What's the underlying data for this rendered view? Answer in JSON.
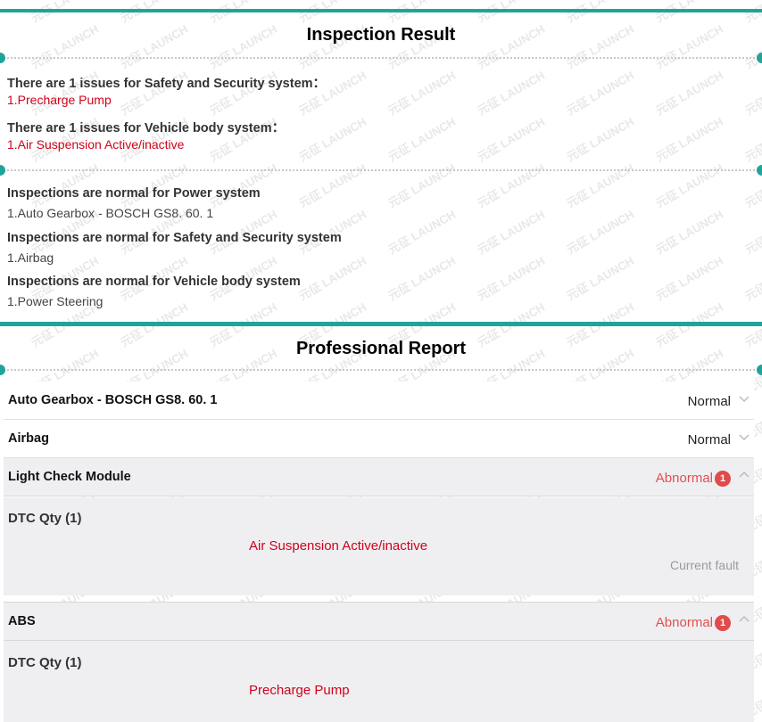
{
  "inspection_result": {
    "title": "Inspection Result",
    "issues": [
      {
        "heading": "There are 1 issues for Safety and Security system：",
        "item": "1.Precharge Pump"
      },
      {
        "heading": "There are 1 issues for Vehicle body system：",
        "item": "1.Air Suspension Active/inactive"
      }
    ],
    "normals": [
      {
        "heading": "Inspections are normal for Power system",
        "item": "1.Auto Gearbox - BOSCH GS8. 60. 1"
      },
      {
        "heading": "Inspections are normal for Safety and Security system",
        "item": "1.Airbag"
      },
      {
        "heading": "Inspections are normal for Vehicle body system",
        "item": "1.Power Steering"
      }
    ]
  },
  "professional_report": {
    "title": "Professional Report",
    "modules": [
      {
        "name": "Auto Gearbox - BOSCH GS8. 60. 1",
        "status": "Normal"
      },
      {
        "name": "Airbag",
        "status": "Normal"
      },
      {
        "name": "Light Check Module",
        "status": "Abnormal",
        "count": "1",
        "dtc_label": "DTC Qty (1)",
        "fault": "Air Suspension Active/inactive",
        "fault_state": "Current fault"
      },
      {
        "name": "ABS",
        "status": "Abnormal",
        "count": "1",
        "dtc_label": "DTC Qty (1)",
        "fault": "Precharge Pump"
      }
    ]
  },
  "watermark": "元征 LAUNCH",
  "colors": {
    "accent": "#20a39a",
    "fault_red": "#d0021b",
    "abnormal": "#e05050"
  }
}
